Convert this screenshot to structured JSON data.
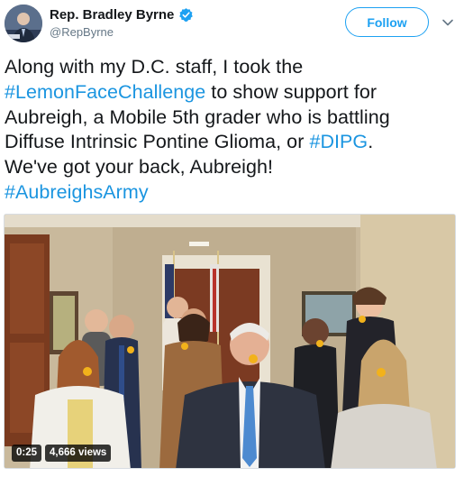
{
  "profile": {
    "display_name": "Rep. Bradley Byrne",
    "handle": "@RepByrne",
    "avatar_icon": "profile-photo",
    "verified_icon": "verified-badge-icon"
  },
  "follow_label": "Follow",
  "tweet": {
    "line1_pre": "Along with my D.C. staff, I took the",
    "line2_tag": "#LemonFaceChallenge",
    "line2_post": " to show support for",
    "line3": "Aubreigh, a Mobile 5th grader who is battling",
    "line4_pre": "Diffuse Intrinsic Pontine Glioma, or ",
    "line4_tag": "#DIPG",
    "line4_post": ".",
    "line5": "We've got your back, Aubreigh!",
    "line6_tag": "#AubreighsArmy"
  },
  "video": {
    "duration": "0:25",
    "views": "4,666 views"
  },
  "colors": {
    "accent": "#1da1f2",
    "hashtag": "#1b95e0",
    "text": "#14171a",
    "muted": "#657786"
  }
}
